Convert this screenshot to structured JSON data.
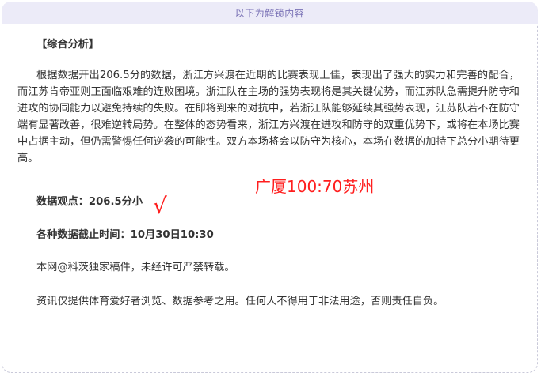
{
  "banner": {
    "text": "以下为解锁内容"
  },
  "article": {
    "section_title": "【综合分析】",
    "paragraph": "根据数据开出206.5分的数据，浙江方兴渡在近期的比赛表现上佳，表现出了强大的实力和完善的配合，而江苏肯帝亚则正面临艰难的连败困境。浙江队在主场的强势表现将是其关键优势，而江苏队急需提升防守和进攻的协同能力以避免持续的失败。在即将到来的对抗中，若浙江队能够延续其强势表现，江苏队若不在防守端有显著改善，很难逆转局势。在整体的态势看来，浙江方兴渡在进攻和防守的双重优势下，或将在本场比赛中占据主动，但仍需警惕任何逆袭的可能性。双方本场将会以防守为核心，本场在数据的加持下总分小期待更高。",
    "data_view": "数据观点：206.5分小",
    "cutoff_time": "各种数据截止时间：10月30日10:30",
    "copyright": "本网@科茨独家稿件，未经许可严禁转载。",
    "disclaimer": "资讯仅提供体育爱好者浏览、数据参考之用。任何人不得用于非法用途，否则责任自负。"
  },
  "annotations": {
    "score_note": "广厦100:70苏州",
    "check": "√",
    "color": "#ff1e1e"
  }
}
